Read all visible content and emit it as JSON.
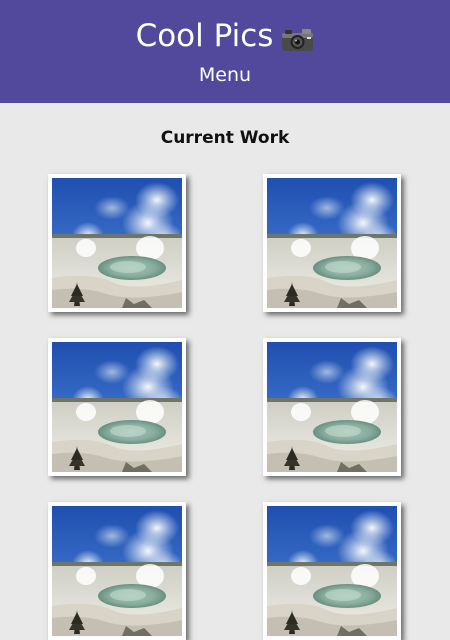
{
  "header": {
    "site_title": "Cool Pics",
    "camera_icon": "camera-icon",
    "menu_label": "Menu",
    "background_color": "#52489c"
  },
  "main": {
    "section_title": "Current Work",
    "photos": [
      {
        "subject": "geyser-basin-photo"
      },
      {
        "subject": "geyser-basin-photo"
      },
      {
        "subject": "geyser-basin-photo"
      },
      {
        "subject": "geyser-basin-photo"
      },
      {
        "subject": "geyser-basin-photo"
      },
      {
        "subject": "geyser-basin-photo"
      }
    ]
  }
}
